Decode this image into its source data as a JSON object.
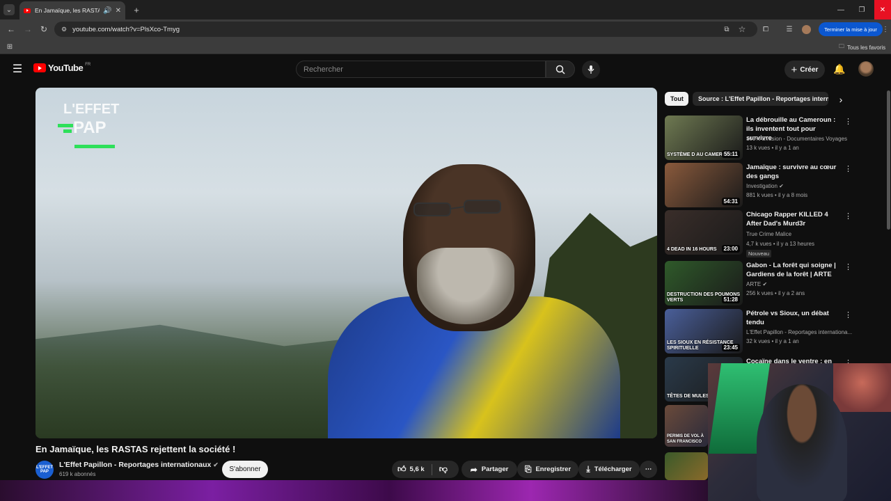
{
  "browser": {
    "tab_title": "En Jamaïque, les RASTAS re",
    "url": "youtube.com/watch?v=PlsXco-Tmyg",
    "update_button": "Terminer la mise à jour",
    "bookmarks_all": "Tous les favoris"
  },
  "youtube": {
    "logo_text": "YouTube",
    "region": "FR",
    "search_placeholder": "Rechercher",
    "create_label": "Créer"
  },
  "video": {
    "title": "En Jamaïque, les RASTAS rejettent la société !",
    "watermark_line1": "L'EFFET",
    "watermark_line2": "PAP",
    "channel_name": "L'Effet Papillon - Reportages internationaux",
    "channel_avatar_text": "L'EFFET PAP",
    "subscribers": "619 k abonnés",
    "subscribe_label": "S'abonner",
    "likes": "5,6 k",
    "share_label": "Partager",
    "save_label": "Enregistrer",
    "download_label": "Télécharger"
  },
  "sidebar": {
    "chips": [
      "Tout",
      "Source : L'Effet Papillon - Reportages interna"
    ],
    "recommendations": [
      {
        "title": "La débrouille au Cameroun : ils inventent tout pour survivre",
        "channel": "100% Evasion - Documentaires Voyages",
        "meta": "13 k vues • il y a 1 an",
        "duration": "55:11",
        "thumb_text": "SYSTÈME D AU CAMEROUN",
        "thumb_color": "#6f7a52"
      },
      {
        "title": "Jamaïque : survivre au cœur des gangs",
        "channel": "Investigation",
        "meta": "881 k vues • il y a 8 mois",
        "duration": "54:31",
        "thumb_text": "",
        "thumb_color": "#8a5a3c"
      },
      {
        "title": "Chicago Rapper KILLED 4 After Dad's Murd3r",
        "channel": "True Crime Malice",
        "meta": "4,7 k vues • il y a 13 heures",
        "duration": "23:00",
        "thumb_text": "4 DEAD IN 16 HOURS",
        "thumb_color": "#3a2e2a",
        "badge": "Nouveau"
      },
      {
        "title": "Gabon - La forêt qui soigne | Gardiens de la forêt | ARTE",
        "channel": "ARTE",
        "meta": "256 k vues • il y a 2 ans",
        "duration": "51:28",
        "thumb_text": "DESTRUCTION DES POUMONS VERTS",
        "thumb_color": "#2f5a2a"
      },
      {
        "title": "Pétrole vs Sioux, un débat tendu",
        "channel": "L'Effet Papillon - Reportages internationa...",
        "meta": "32 k vues • il y a 1 an",
        "duration": "23:45",
        "thumb_text": "LES SIOUX EN RÉSISTANCE SPIRITUELLE",
        "thumb_color": "#4a5f9a"
      },
      {
        "title": "Cocaïne dans le ventre : en",
        "channel": "",
        "meta": "",
        "duration": "",
        "thumb_text": "TÊTES DE MULES",
        "thumb_color": "#2a3a4a"
      }
    ],
    "partial_thumbs": [
      "PERMIS DE VOL À SAN FRANCISCO",
      ""
    ]
  },
  "colors": {
    "brand_red": "#ff0000",
    "update_blue": "#0b57d0",
    "background": "#0f0f0f"
  }
}
